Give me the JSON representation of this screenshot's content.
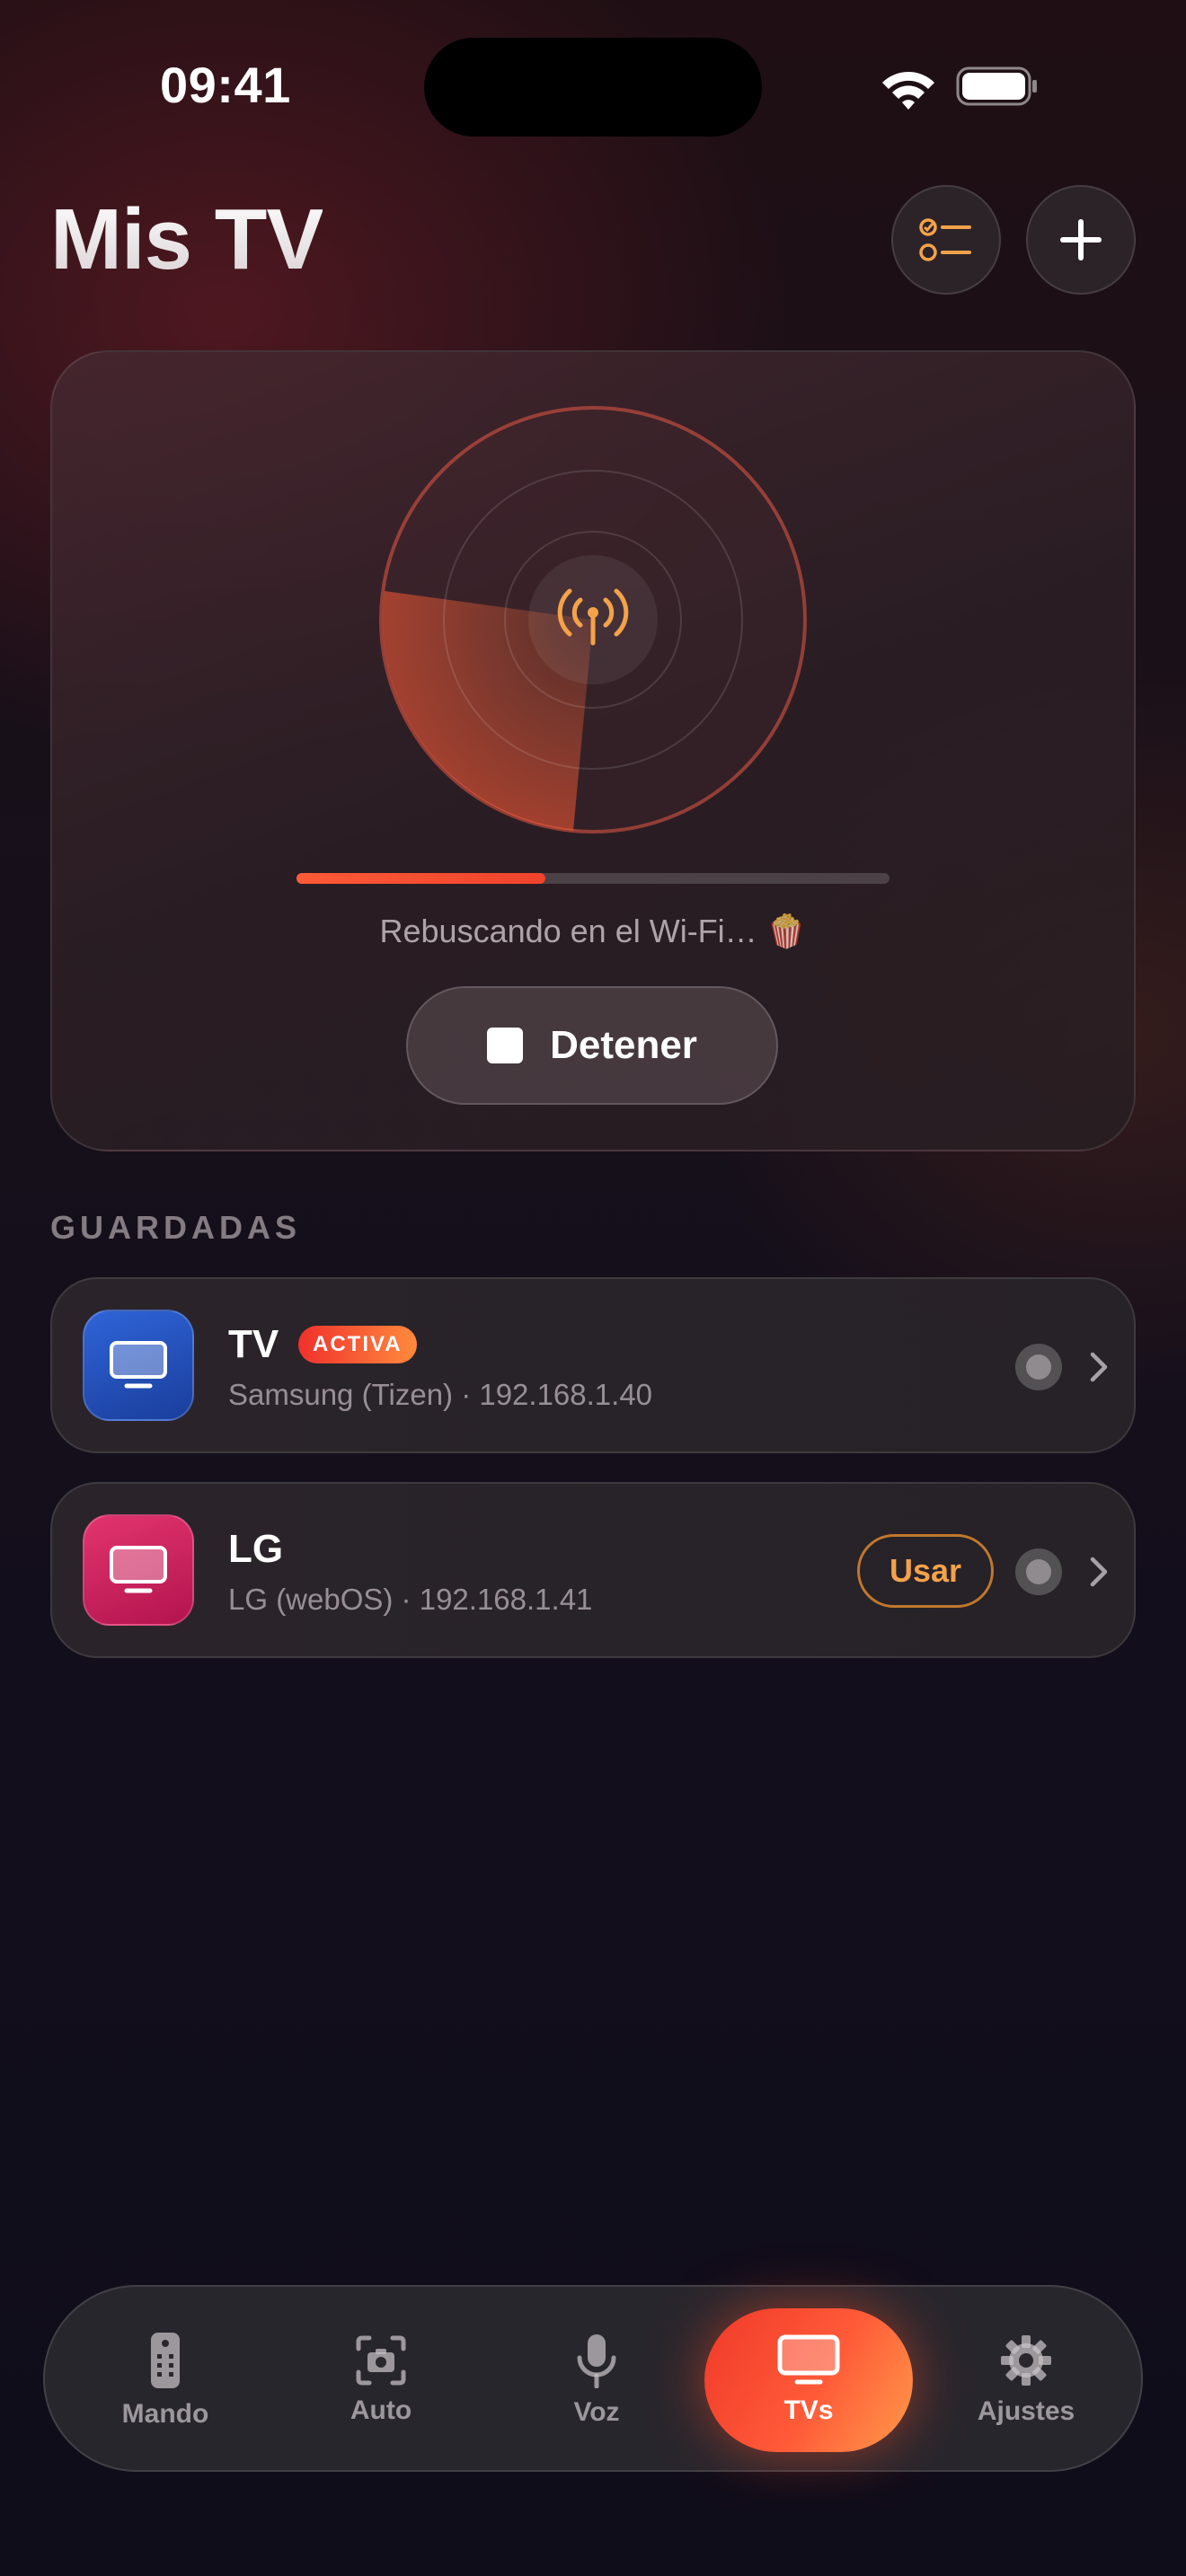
{
  "status_bar": {
    "time": "09:41"
  },
  "header": {
    "title": "Mis TV",
    "checklist_icon": "checklist-icon",
    "add_icon": "plus-icon"
  },
  "scan": {
    "status_text": "Rebuscando en el Wi-Fi… 🍿",
    "progress": 0.42,
    "stop_label": "Detener",
    "center_icon": "antenna-broadcast-icon"
  },
  "saved": {
    "section_label": "GUARDADAS",
    "items": [
      {
        "name": "TV",
        "badge": "ACTIVA",
        "subtitle": "Samsung (Tizen) · 192.168.1.40",
        "color": "#2455c4",
        "icon": "tv-icon"
      },
      {
        "name": "LG",
        "action_label": "Usar",
        "subtitle": "LG (webOS) · 192.168.1.41",
        "color": "#d0245e",
        "icon": "tv-icon"
      }
    ]
  },
  "tabs": [
    {
      "label": "Mando",
      "icon": "remote-icon"
    },
    {
      "label": "Auto",
      "icon": "camera-scan-icon"
    },
    {
      "label": "Voz",
      "icon": "microphone-icon"
    },
    {
      "label": "TVs",
      "icon": "tv-icon",
      "active": true
    },
    {
      "label": "Ajustes",
      "icon": "gear-icon"
    }
  ],
  "colors": {
    "accent": "#ff5a36",
    "accent_orange": "#f4a24a"
  }
}
